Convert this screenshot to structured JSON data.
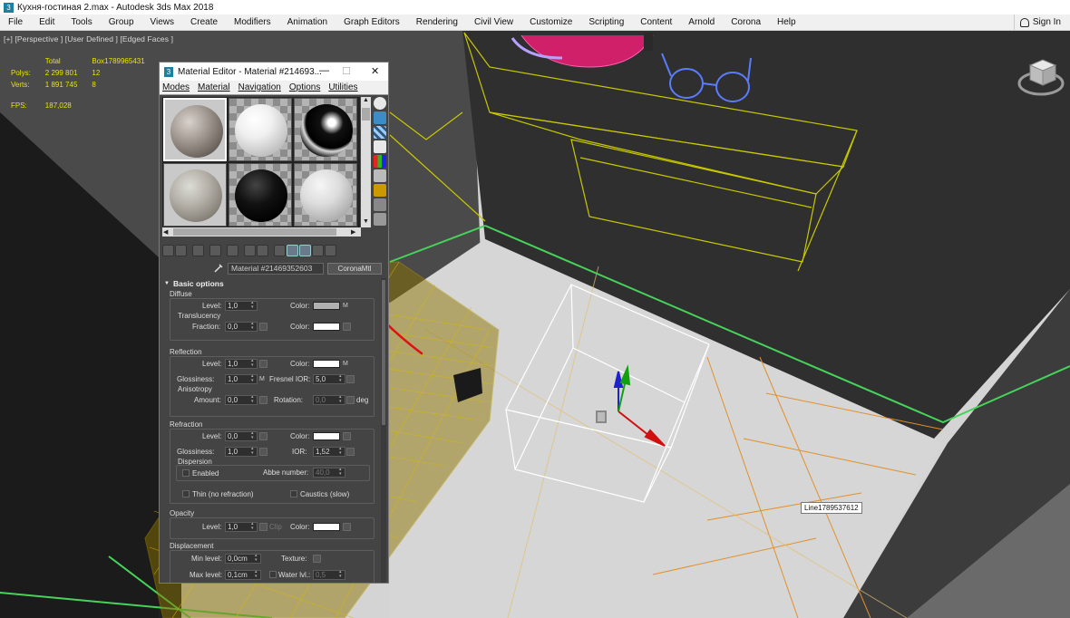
{
  "window": {
    "title": "Кухня-гостиная 2.max - Autodesk 3ds Max 2018",
    "signin": "Sign In"
  },
  "menu": [
    "File",
    "Edit",
    "Tools",
    "Group",
    "Views",
    "Create",
    "Modifiers",
    "Animation",
    "Graph Editors",
    "Rendering",
    "Civil View",
    "Customize",
    "Scripting",
    "Content",
    "Arnold",
    "Corona",
    "Help"
  ],
  "viewport": {
    "label": "[+] [Perspective ] [User Defined ] [Edged Faces ]",
    "stats": {
      "total_label": "Total",
      "object_label": "Box1789965431",
      "polys_label": "Polys:",
      "polys_total": "2 299 801",
      "polys_object": "12",
      "verts_label": "Verts:",
      "verts_total": "1 891 745",
      "verts_object": "8",
      "fps_label": "FPS:",
      "fps_value": "187,028"
    },
    "tooltip": "Line1789537612"
  },
  "material_editor": {
    "title": "Material Editor - Material #214693...",
    "minimize": "—",
    "maximize": "☐",
    "close": "✕",
    "menu": [
      "Modes",
      "Material",
      "Navigation",
      "Options",
      "Utilities"
    ],
    "material_name": "Material #21469352603",
    "material_type_button": "CoronaMtl",
    "rollout_title": "Basic options",
    "diffuse": {
      "title": "Diffuse",
      "level_label": "Level:",
      "level_value": "1,0",
      "color_label": "Color:",
      "color": "#b0b0b0",
      "map_tag": "M",
      "translucency_title": "Translucency",
      "fraction_label": "Fraction:",
      "fraction_value": "0,0",
      "trans_color_label": "Color:",
      "trans_color": "#ffffff"
    },
    "reflection": {
      "title": "Reflection",
      "level_label": "Level:",
      "level_value": "1,0",
      "color_label": "Color:",
      "color": "#ffffff",
      "map_tag": "M",
      "glossiness_label": "Glossiness:",
      "glossiness_value": "1,0",
      "gloss_map_tag": "M",
      "fresnel_label": "Fresnel IOR:",
      "fresnel_value": "5,0",
      "anisotropy_title": "Anisotropy",
      "amount_label": "Amount:",
      "amount_value": "0,0",
      "rotation_label": "Rotation:",
      "rotation_value": "0,0",
      "deg_label": "deg"
    },
    "refraction": {
      "title": "Refraction",
      "level_label": "Level:",
      "level_value": "0,0",
      "color_label": "Color:",
      "color": "#ffffff",
      "glossiness_label": "Glossiness:",
      "glossiness_value": "1,0",
      "ior_label": "IOR:",
      "ior_value": "1,52",
      "dispersion_title": "Dispersion",
      "enabled_label": "Enabled",
      "abbe_label": "Abbe number:",
      "abbe_value": "40,0",
      "thin_label": "Thin (no refraction)",
      "caustics_label": "Caustics (slow)"
    },
    "opacity": {
      "title": "Opacity",
      "level_label": "Level:",
      "level_value": "1,0",
      "clip_label": "Clip",
      "color_label": "Color:",
      "color": "#ffffff"
    },
    "displacement": {
      "title": "Displacement",
      "min_label": "Min level:",
      "min_value": "0,0cm",
      "texture_label": "Texture:",
      "max_label": "Max level:",
      "max_value": "0,1cm",
      "water_label": "Water lvl.:",
      "water_value": "0,5"
    }
  },
  "colors": {
    "selection_yellow": "#c8c800",
    "wireframe_gold": "#b39500",
    "annotation_red": "#e01010",
    "floor_light": "#d6d6d6",
    "wall_dark": "#333333"
  }
}
